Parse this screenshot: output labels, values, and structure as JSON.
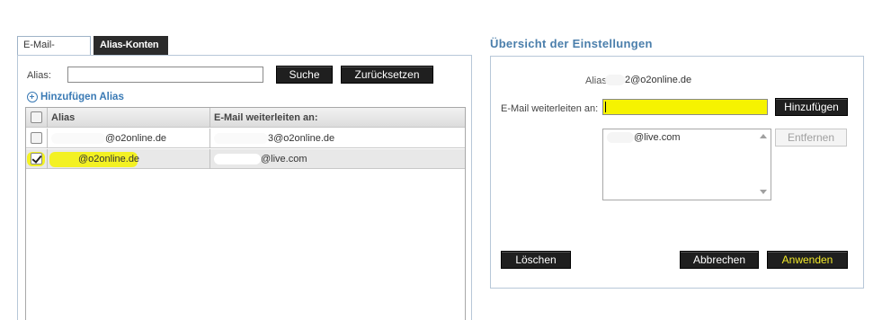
{
  "tabs": [
    {
      "label": "E-Mail-Konten",
      "active": false
    },
    {
      "label": "Alias-Konten",
      "active": true
    }
  ],
  "search": {
    "alias_label": "Alias:",
    "alias_value": "",
    "search_button": "Suche",
    "reset_button": "Zurücksetzen"
  },
  "add_alias_label": "Hinzufügen Alias",
  "table": {
    "columns": [
      "Alias",
      "E-Mail weiterleiten an:"
    ],
    "rows": [
      {
        "alias": "@o2online.de",
        "forward": "3@o2online.de",
        "checked": false
      },
      {
        "alias": "@o2online.de",
        "forward": "@live.com",
        "checked": true
      }
    ]
  },
  "overview": {
    "title": "Übersicht der Einstellungen",
    "alias_label": "Alias:",
    "alias_value": "2@o2online.de",
    "forward_label": "E-Mail weiterleiten an:",
    "forward_value": "",
    "add_button": "Hinzufügen",
    "list_items": [
      "@live.com"
    ],
    "remove_button": "Entfernen",
    "delete_button": "Löschen",
    "cancel_button": "Abbrechen",
    "apply_button": "Anwenden"
  },
  "colors": {
    "highlight": "#f4f200",
    "dark_button": "#1f1f1f",
    "link_blue": "#3a7ab5",
    "apply_text": "#f2ea2a"
  }
}
